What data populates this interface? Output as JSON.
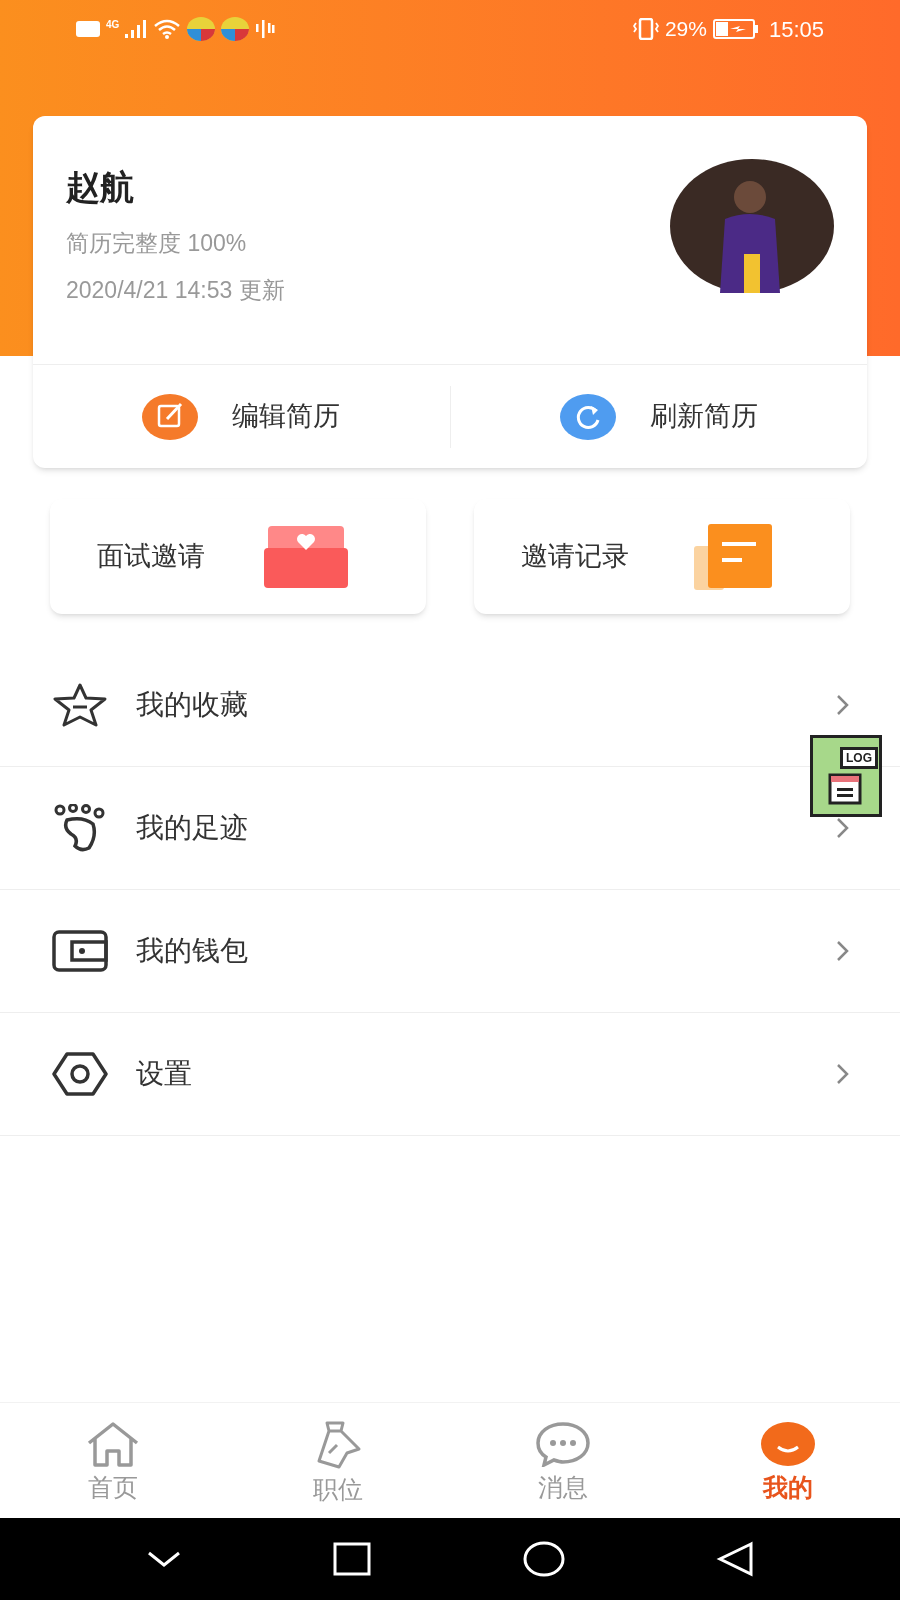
{
  "status_bar": {
    "network": "4G",
    "battery": "29%",
    "time": "15:05"
  },
  "profile": {
    "name": "赵航",
    "completeness": "简历完整度 100%",
    "updated": "2020/4/21 14:53 更新"
  },
  "actions": [
    {
      "label": "编辑简历"
    },
    {
      "label": "刷新简历"
    }
  ],
  "quick_links": [
    {
      "label": "面试邀请"
    },
    {
      "label": "邀请记录"
    }
  ],
  "menu": [
    {
      "label": "我的收藏"
    },
    {
      "label": "我的足迹"
    },
    {
      "label": "我的钱包"
    },
    {
      "label": "设置"
    }
  ],
  "log_button": {
    "label": "LOG"
  },
  "tabs": [
    {
      "label": "首页",
      "selected": false
    },
    {
      "label": "职位",
      "selected": false
    },
    {
      "label": "消息",
      "selected": false
    },
    {
      "label": "我的",
      "selected": true
    }
  ]
}
